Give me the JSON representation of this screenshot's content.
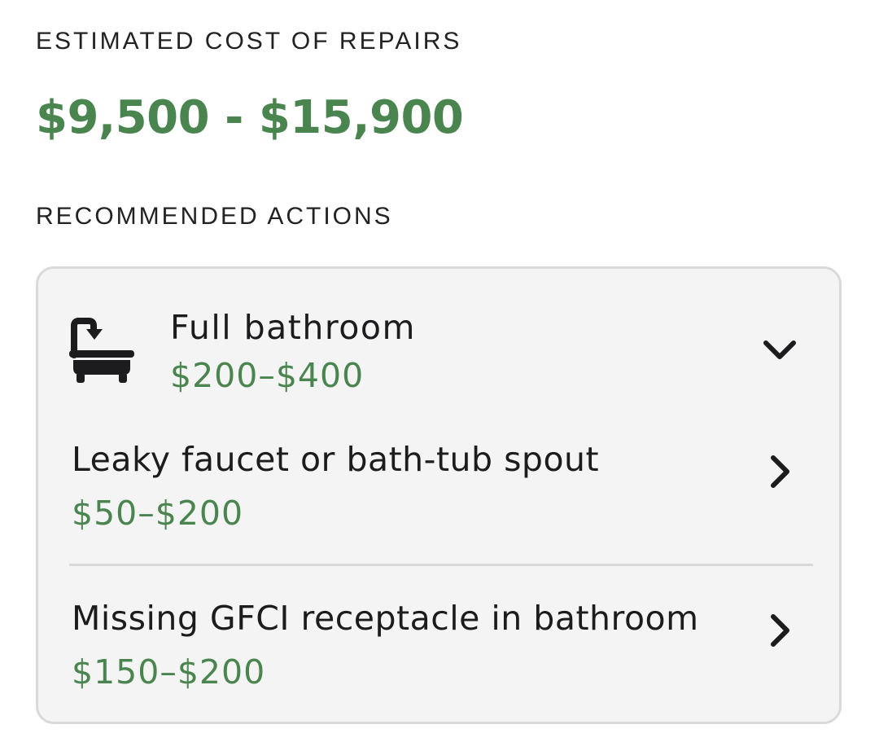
{
  "estimate": {
    "label": "ESTIMATED COST OF REPAIRS",
    "range": "$9,500 - $15,900"
  },
  "recommended": {
    "label": "RECOMMENDED ACTIONS",
    "category": {
      "icon": "bathtub-icon",
      "title": "Full bathroom",
      "price": "$200–$400",
      "expanded": true
    },
    "items": [
      {
        "title": "Leaky faucet or bath-tub spout",
        "price": "$50–$200"
      },
      {
        "title": "Missing GFCI receptacle in bathroom",
        "price": "$150–$200"
      }
    ]
  },
  "colors": {
    "accent_green": "#4a8550",
    "card_background": "#f4f4f4",
    "card_border": "#d9d9d9",
    "text": "#1c1c1e"
  }
}
